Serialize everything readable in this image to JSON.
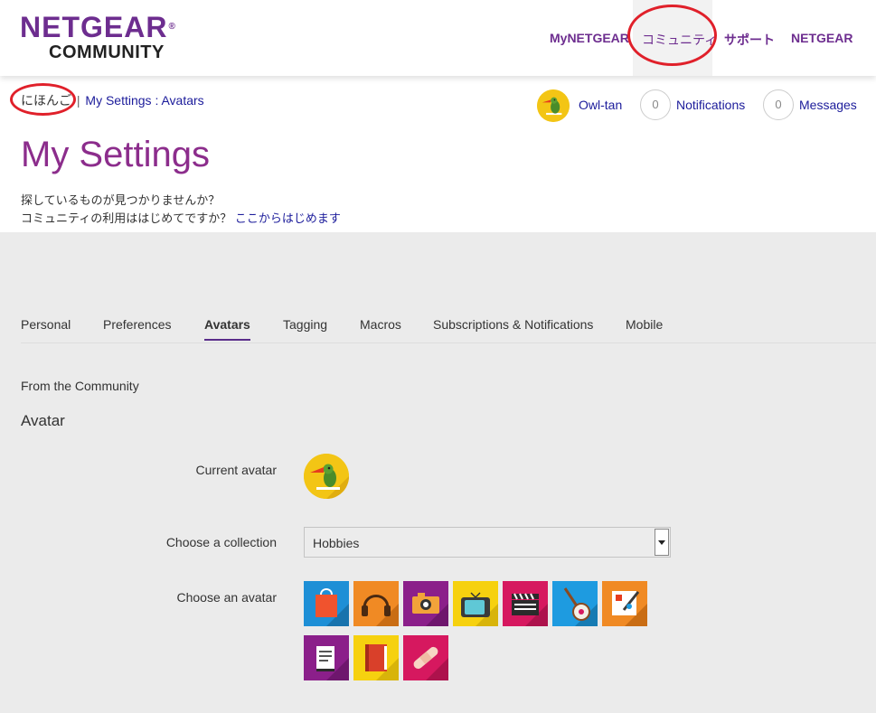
{
  "header": {
    "logo_top": "NETGEAR",
    "logo_reg": "®",
    "logo_bottom": "COMMUNITY",
    "nav": [
      {
        "label": "MyNETGEAR"
      },
      {
        "label": "コミュニティ"
      },
      {
        "label": "サポート"
      },
      {
        "label": "NETGEAR"
      }
    ]
  },
  "breadcrumb": {
    "language": "にほんご",
    "separator": ":",
    "items": [
      {
        "label": "My Settings"
      },
      {
        "label": "Avatars"
      }
    ]
  },
  "userbar": {
    "username": "Owl-tan",
    "notifications_count": "0",
    "notifications_label": "Notifications",
    "messages_count": "0",
    "messages_label": "Messages"
  },
  "page": {
    "title": "My Settings",
    "help_line1": "探しているものが見つかりませんか？",
    "help_line2_prefix": "コミュニティの利用ははじめてですか？",
    "help_line2_link": "ここからはじめます"
  },
  "tabs": [
    {
      "label": "Personal"
    },
    {
      "label": "Preferences"
    },
    {
      "label": "Avatars",
      "active": true
    },
    {
      "label": "Tagging"
    },
    {
      "label": "Macros"
    },
    {
      "label": "Subscriptions & Notifications"
    },
    {
      "label": "Mobile"
    }
  ],
  "content": {
    "section_label": "From the Community",
    "section_title": "Avatar",
    "current_avatar_label": "Current avatar",
    "collection_label": "Choose a collection",
    "collection_value": "Hobbies",
    "choose_avatar_label": "Choose an avatar"
  },
  "avatars": [
    {
      "icon": "shopping-bag",
      "color": "#1e8fd6"
    },
    {
      "icon": "headphones",
      "color": "#f08a24"
    },
    {
      "icon": "camera",
      "color": "#8b1f8a"
    },
    {
      "icon": "television",
      "color": "#f6d10f"
    },
    {
      "icon": "clapperboard",
      "color": "#d6185f"
    },
    {
      "icon": "banjo",
      "color": "#1e9be0"
    },
    {
      "icon": "painting",
      "color": "#f08a24"
    },
    {
      "icon": "document",
      "color": "#8b1f8a"
    },
    {
      "icon": "book",
      "color": "#f6d10f"
    },
    {
      "icon": "bandage",
      "color": "#d6185f"
    }
  ],
  "colors": {
    "brand_purple": "#6d2d8f",
    "title_purple": "#8c2d8c",
    "link_blue": "#1c1c9b",
    "annotation_red": "#e0202a"
  }
}
